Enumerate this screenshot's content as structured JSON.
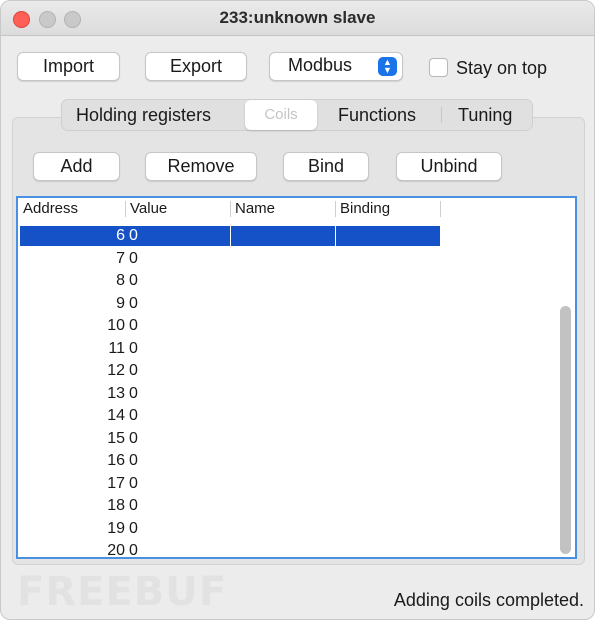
{
  "window": {
    "title": "233:unknown slave"
  },
  "toolbar": {
    "import_label": "Import",
    "export_label": "Export",
    "protocol_selected": "Modbus",
    "stay_on_top_label": "Stay on top",
    "stay_on_top_checked": false
  },
  "tabs": [
    {
      "label": "Holding registers",
      "selected": false
    },
    {
      "label": "Coils",
      "selected": true
    },
    {
      "label": "Functions",
      "selected": false
    },
    {
      "label": "Tuning",
      "selected": false
    }
  ],
  "actions": {
    "add_label": "Add",
    "remove_label": "Remove",
    "bind_label": "Bind",
    "unbind_label": "Unbind"
  },
  "table": {
    "columns": [
      "Address",
      "Value",
      "Name",
      "Binding"
    ],
    "rows": [
      {
        "address": "6",
        "value": "0",
        "selected": true
      },
      {
        "address": "7",
        "value": "0"
      },
      {
        "address": "8",
        "value": "0"
      },
      {
        "address": "9",
        "value": "0"
      },
      {
        "address": "10",
        "value": "0"
      },
      {
        "address": "11",
        "value": "0"
      },
      {
        "address": "12",
        "value": "0"
      },
      {
        "address": "13",
        "value": "0"
      },
      {
        "address": "14",
        "value": "0"
      },
      {
        "address": "15",
        "value": "0"
      },
      {
        "address": "16",
        "value": "0"
      },
      {
        "address": "17",
        "value": "0"
      },
      {
        "address": "18",
        "value": "0"
      },
      {
        "address": "19",
        "value": "0"
      },
      {
        "address": "20",
        "value": "0"
      }
    ]
  },
  "status": {
    "text": "Adding coils completed."
  },
  "watermark": {
    "text": "FREEBUF"
  },
  "colors": {
    "selection": "#1552c8",
    "focus_ring": "#4a90e2",
    "close": "#fe5f57"
  }
}
